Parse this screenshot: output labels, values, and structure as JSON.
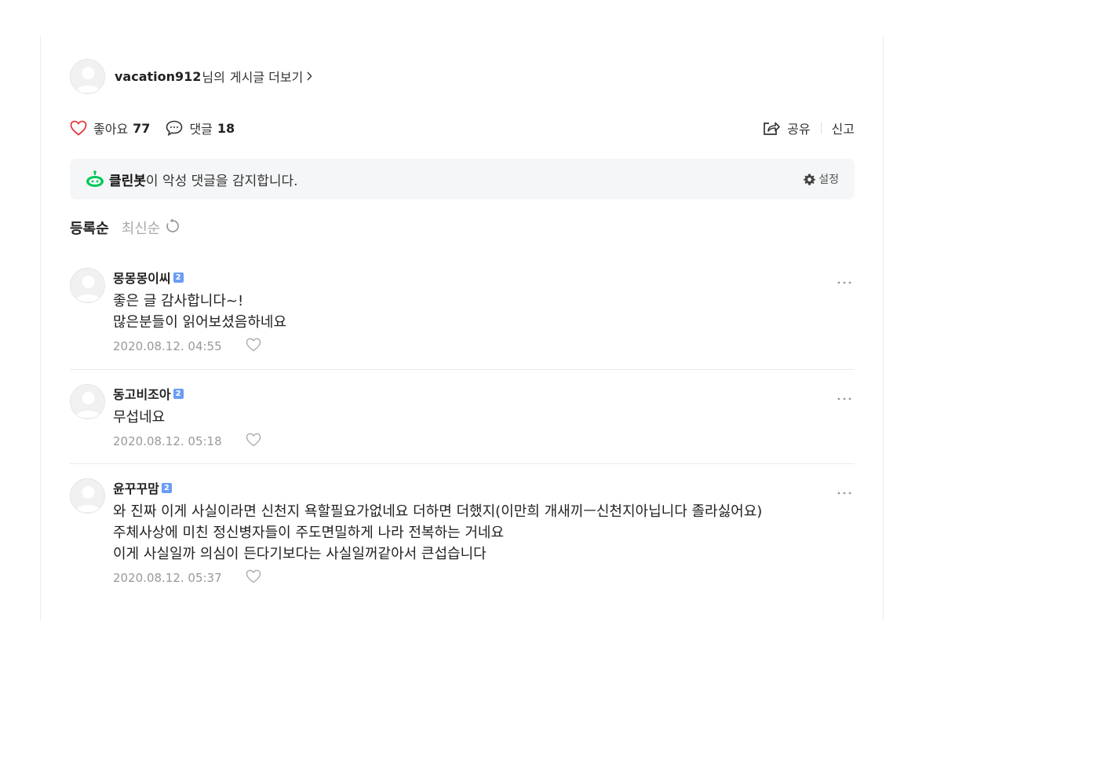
{
  "author": {
    "name": "vacation912",
    "suffix": "님의",
    "more_posts_label": "게시글 더보기"
  },
  "actions": {
    "like_label": "좋아요",
    "like_count": "77",
    "comment_label": "댓글",
    "comment_count": "18",
    "share_label": "공유",
    "report_label": "신고"
  },
  "cleanbot": {
    "name": "클린봇",
    "message": "이 악성 댓글을 감지합니다.",
    "settings_label": "설정",
    "icon_color": "#03c75a"
  },
  "sort": {
    "active": "등록순",
    "inactive": "최신순"
  },
  "comments": [
    {
      "nickname": "몽몽몽이씨",
      "badge": "2",
      "text": "좋은 글 감사합니다~!\n많은분들이 읽어보셨음하네요",
      "date": "2020.08.12. 04:55"
    },
    {
      "nickname": "동고비조아",
      "badge": "2",
      "text": "무섭네요",
      "date": "2020.08.12. 05:18"
    },
    {
      "nickname": "윤꾸꾸맘",
      "badge": "2",
      "text": "와 진짜 이게 사실이라면 신천지 욕할필요가없네요 더하면 더했지(이만희 개새끼ㅡ신천지아닙니다 졸라싫어요)\n주체사상에 미친 정신병자들이 주도면밀하게 나라 전복하는 거네요\n이게 사실일까 의심이 든다기보다는 사실일꺼같아서 큰섭습니다",
      "date": "2020.08.12. 05:37"
    }
  ],
  "colors": {
    "like_heart": "#e0393e",
    "badge": "#6b9cf5",
    "cleanbot_bg": "#f5f6f7"
  },
  "icons": [
    "avatar-placeholder-icon",
    "heart-icon",
    "comment-bubble-icon",
    "share-icon",
    "cleanbot-icon",
    "gear-icon",
    "refresh-icon",
    "more-dots-icon",
    "chevron-right-icon"
  ]
}
